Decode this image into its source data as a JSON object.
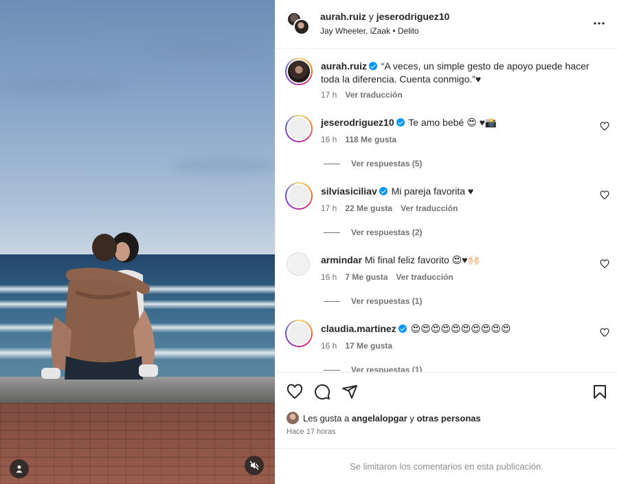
{
  "header": {
    "user1": "aurah.ruiz",
    "connector": " y ",
    "user2": "jeserodriguez10",
    "subtitle": "Jay Wheeler, iZaak • Delito"
  },
  "caption": {
    "username": "aurah.ruiz",
    "text": "“A veces, un simple gesto de apoyo puede hacer toda la diferencia. Cuenta conmigo.”♥",
    "time": "17 h",
    "translate": "Ver traducción"
  },
  "comments": [
    {
      "username": "jeserodriguez10",
      "verified": true,
      "text": "Te amo bebé 😍 ♥📸",
      "time": "16 h",
      "likes": "118 Me gusta",
      "translate": "",
      "replies": "Ver respuestas (5)"
    },
    {
      "username": "silviasiciliav",
      "verified": true,
      "text": "Mi pareja favorita ♥",
      "time": "17 h",
      "likes": "22 Me gusta",
      "translate": "Ver traducción",
      "replies": "Ver respuestas (2)"
    },
    {
      "username": "armindar",
      "verified": false,
      "text": "Mi final feliz favorito 😍♥🙌🏻",
      "time": "16 h",
      "likes": "7 Me gusta",
      "translate": "Ver traducción",
      "replies": "Ver respuestas (1)"
    },
    {
      "username": "claudia.martinez",
      "verified": true,
      "text": "😍😍😍😍😍😍😍😍😍😍",
      "time": "16 h",
      "likes": "17 Me gusta",
      "translate": "",
      "replies": "Ver respuestas (1)"
    }
  ],
  "likes": {
    "prefix": "Les gusta a ",
    "user": "angelalopgar",
    "suffix": " y ",
    "others": "otras personas"
  },
  "posted": "Hace 17 horas",
  "footer_note": "Se limitaron los comentarios en esta publicación.",
  "icons": [
    "heart-icon",
    "comment-icon",
    "share-icon",
    "bookmark-icon",
    "more-icon",
    "user-tag-icon",
    "mute-icon"
  ],
  "colors": {
    "verified": "#0095f6",
    "secondary_text": "#737373",
    "divider": "#efefef"
  }
}
